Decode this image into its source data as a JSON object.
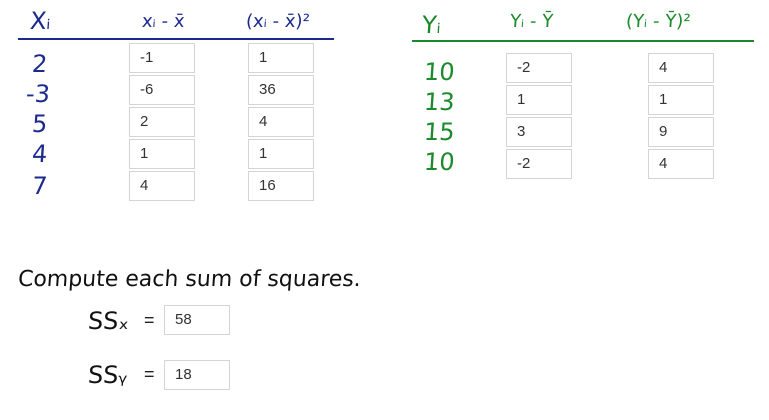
{
  "x_table": {
    "headers": [
      "Xᵢ",
      "xᵢ - x̄",
      "(xᵢ - x̄)²"
    ],
    "xi": [
      "2",
      "-3",
      "5",
      "4",
      "7"
    ],
    "deviation": [
      "-1",
      "-6",
      "2",
      "1",
      "4"
    ],
    "squared": [
      "1",
      "36",
      "4",
      "1",
      "16"
    ]
  },
  "y_table": {
    "headers": [
      "Yᵢ",
      "Yᵢ - Ȳ",
      "(Yᵢ - Ȳ)²"
    ],
    "yi": [
      "10",
      "13",
      "15",
      "10"
    ],
    "deviation": [
      "-2",
      "1",
      "3",
      "-2"
    ],
    "squared": [
      "4",
      "1",
      "9",
      "4"
    ]
  },
  "prompt": "Compute each sum of squares.",
  "ssx": {
    "label": "SSₓ",
    "equals": "=",
    "value": "58"
  },
  "ssy": {
    "label": "SSᵧ",
    "equals": "=",
    "value": "18"
  },
  "colors": {
    "x_ink": "#1c2a8e",
    "y_ink": "#1a8a2a",
    "prompt_ink": "#111111"
  }
}
